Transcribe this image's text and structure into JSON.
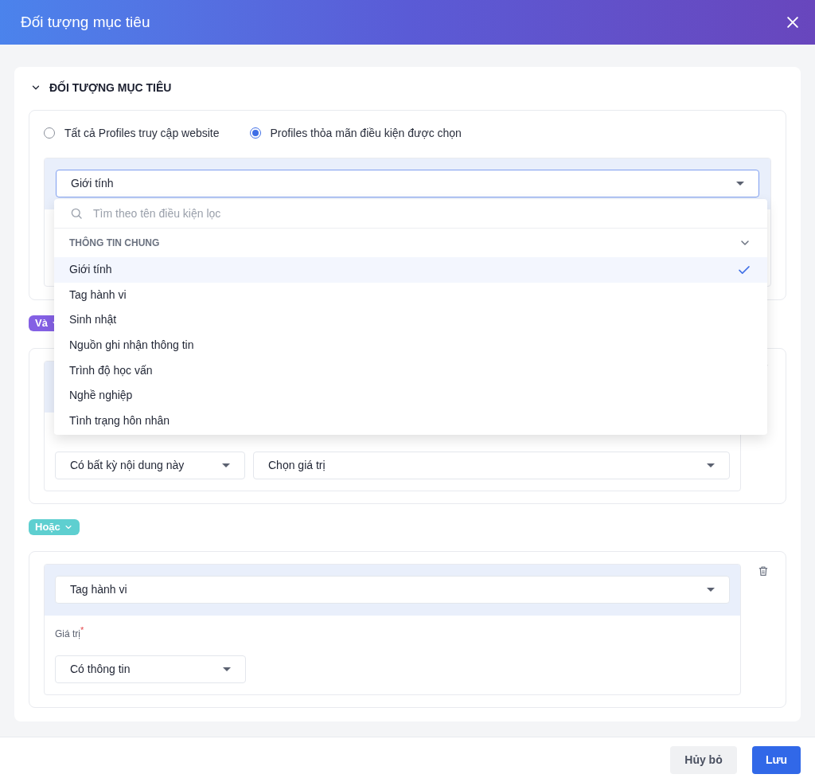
{
  "dialog": {
    "title": "Đối tượng mục tiêu"
  },
  "section": {
    "title": "ĐỐI TƯỢNG MỤC TIÊU",
    "expanded": true
  },
  "audience_options": [
    {
      "label": "Tất cả Profiles truy cập website",
      "selected": false
    },
    {
      "label": "Profiles thỏa mãn điều kiện được chọn",
      "selected": true
    }
  ],
  "conditions": [
    {
      "field": "Giới tính",
      "field_open": true
    },
    {
      "connector": {
        "label": "Và",
        "kind": "and"
      },
      "operator": "Có bất kỳ nội dung này",
      "value_placeholder": "Chọn giá trị"
    },
    {
      "connector": {
        "label": "Hoặc",
        "kind": "or"
      },
      "field": "Tag hành vi",
      "field_open": false,
      "value_label": "Giá trị",
      "required": true,
      "required_mark": "*",
      "operator": "Có thông tin"
    }
  ],
  "dropdown": {
    "search_placeholder": "Tìm theo tên điều kiện lọc",
    "group": {
      "title": "THÔNG TIN CHUNG",
      "expanded": true
    },
    "items": [
      {
        "label": "Giới tính",
        "selected": true
      },
      {
        "label": "Tag hành vi",
        "selected": false
      },
      {
        "label": "Sinh nhật",
        "selected": false
      },
      {
        "label": "Nguồn ghi nhận thông tin",
        "selected": false
      },
      {
        "label": "Trình độ học vấn",
        "selected": false
      },
      {
        "label": "Nghề nghiệp",
        "selected": false
      },
      {
        "label": "Tình trạng hôn nhân",
        "selected": false
      }
    ]
  },
  "footer": {
    "buttons": [
      {
        "label": "Hủy bỏ",
        "kind": "secondary"
      },
      {
        "label": "Lưu",
        "kind": "primary"
      }
    ]
  }
}
